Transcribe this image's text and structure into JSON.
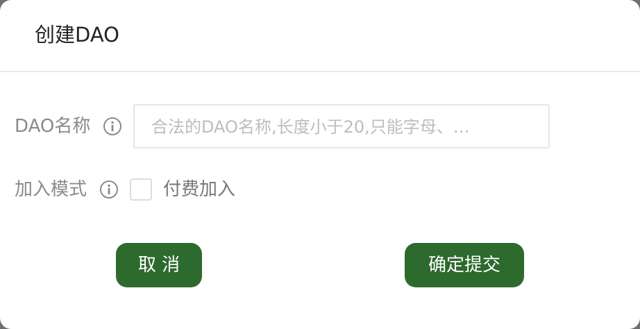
{
  "dialog": {
    "title": "创建DAO"
  },
  "form": {
    "name_field": {
      "label": "DAO名称",
      "icon": "info-icon",
      "value": "",
      "placeholder": "合法的DAO名称,长度小于20,只能字母、…"
    },
    "join_mode": {
      "label": "加入模式",
      "icon": "info-icon",
      "checked": false,
      "option_label": "付费加入"
    }
  },
  "buttons": {
    "cancel_label": "取 消",
    "submit_label": "确定提交"
  },
  "colors": {
    "button_bg": "#2d6a2d",
    "label_text": "#8a8a8a",
    "placeholder_text": "#bdbdbd"
  }
}
